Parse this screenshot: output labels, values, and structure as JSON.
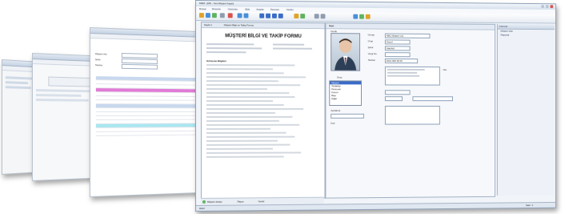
{
  "app": {
    "title": "MSM - [MS - Yeni Müşteri Kaydı]",
    "menu": [
      "Dosya",
      "Düzenle",
      "Görünüm",
      "Ekle",
      "Araçlar",
      "Pencere",
      "Yardım"
    ]
  },
  "back_window_3": {
    "fields": [
      "Müşteri Adı",
      "Şube",
      "Telefon"
    ]
  },
  "doc": {
    "tabs": [
      "Sayfa 1",
      "Müşteri Bilgi ve Takip Formu"
    ],
    "heading": "MÜŞTERİ BİLGİ VE TAKİP FORMU",
    "section_label": "Görüşme Bilgileri",
    "bottom_tabs": [
      "Müşteri detayı",
      "Rapor",
      "Yazdır"
    ]
  },
  "card": {
    "tab": "Kart",
    "section": "Kimlik",
    "fields": [
      {
        "label": "Ünvan",
        "value": "ABC Müşteri Ltd."
      },
      {
        "label": "Grup",
        "value": "Genel"
      },
      {
        "label": "Şehir",
        "value": "İstanbul"
      },
      {
        "label": "Vergi No",
        "value": ""
      },
      {
        "label": "Telefon",
        "value": "0212 000 00 00"
      }
    ],
    "list_title": "Grup",
    "list_items": [
      "Müşteri",
      "Tedarikçi",
      "Personel",
      "Kurum",
      "Bayi",
      "Diğer"
    ],
    "list_selected": 0,
    "side_label": "Not",
    "bottom_labels": [
      "Açıklama",
      "Kod"
    ]
  },
  "right_panel": {
    "title": "Görevler",
    "items": [
      "Müşteri ekle",
      "Raporlar"
    ]
  },
  "status": {
    "left": "Hazır",
    "right": "Satır: 1"
  },
  "colors": {
    "selection": "#3a6bc7",
    "pink_row": "#e37ad6",
    "cyan_row": "#a9e7f1"
  }
}
